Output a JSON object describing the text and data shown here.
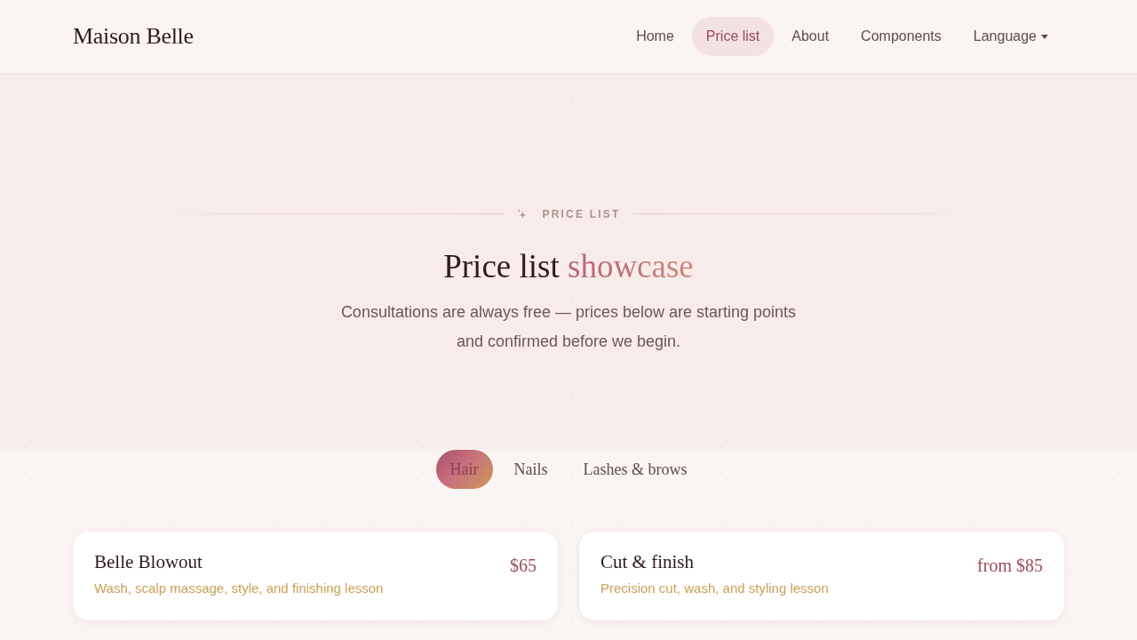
{
  "header": {
    "logo": "Maison Belle",
    "nav": [
      {
        "label": "Home",
        "kind": "link",
        "selected": false
      },
      {
        "label": "Price list",
        "kind": "link",
        "selected": true
      },
      {
        "label": "About",
        "kind": "link",
        "selected": false
      },
      {
        "label": "Components",
        "kind": "link",
        "selected": false
      },
      {
        "label": "Language",
        "kind": "dropdown",
        "selected": false
      }
    ]
  },
  "hero": {
    "eyebrow": "PRICE LIST",
    "heading": "Price list",
    "heading_accent": "showcase",
    "intro": "Consultations are always free — prices below are starting points and confirmed before we begin."
  },
  "tabs": [
    {
      "label": "Hair",
      "selected": true
    },
    {
      "label": "Nails",
      "selected": false
    },
    {
      "label": "Lashes & brows",
      "selected": false
    }
  ],
  "services": [
    {
      "name": "Belle Blowout",
      "description": "Wash, scalp massage, style, and finishing lesson",
      "price": "$65"
    },
    {
      "name": "Cut & finish",
      "description": "Precision cut, wash, and styling lesson",
      "price": "from $85"
    }
  ]
}
